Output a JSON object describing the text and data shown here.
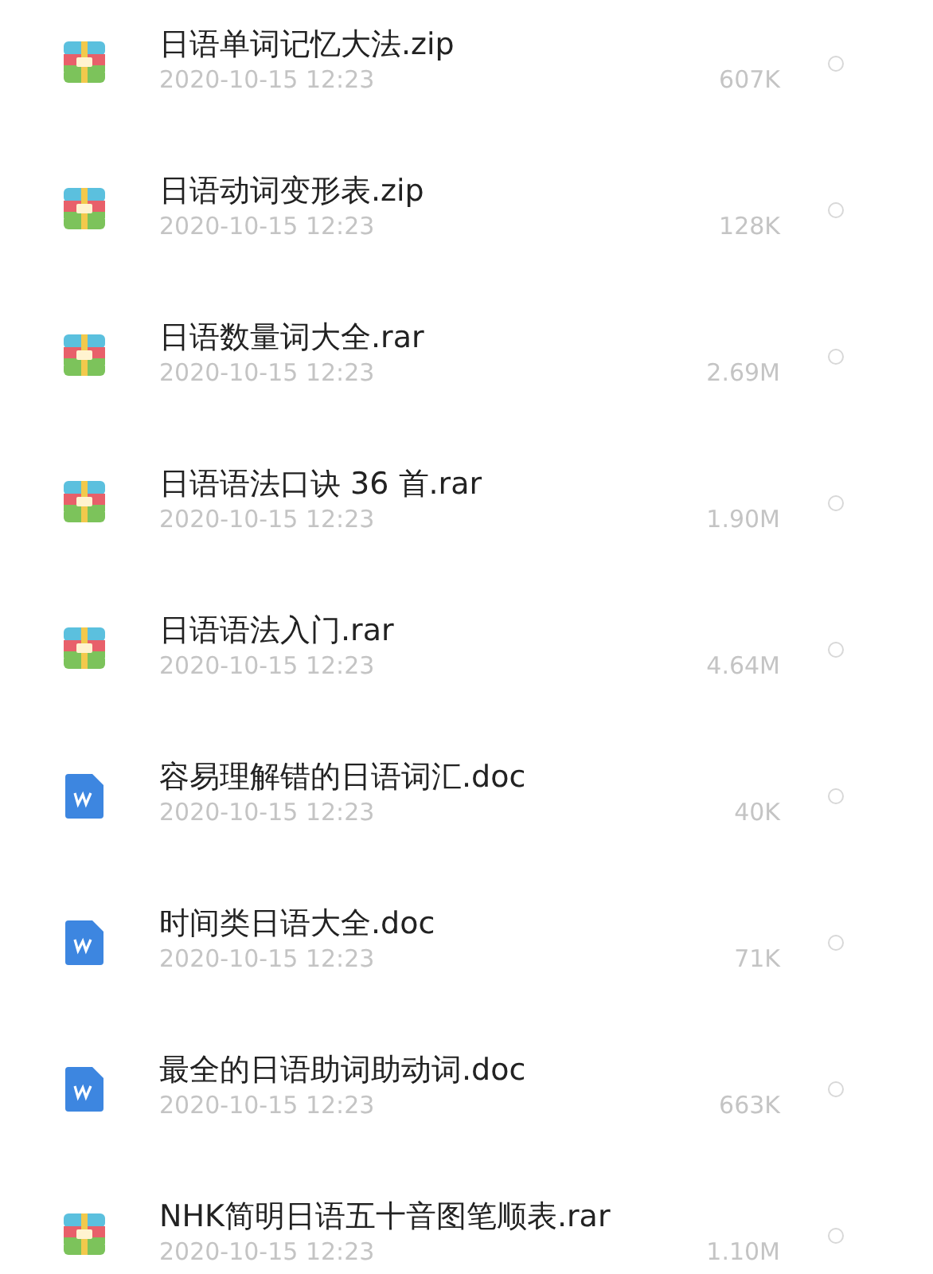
{
  "files": [
    {
      "kind": "archive",
      "name": "日语单词记忆大法.zip",
      "date": "2020-10-15 12:23",
      "size": "607K",
      "selected": false
    },
    {
      "kind": "archive",
      "name": "日语动词变形表.zip",
      "date": "2020-10-15 12:23",
      "size": "128K",
      "selected": false
    },
    {
      "kind": "archive",
      "name": "日语数量词大全.rar",
      "date": "2020-10-15 12:23",
      "size": "2.69M",
      "selected": false
    },
    {
      "kind": "archive",
      "name": "日语语法口诀 36 首.rar",
      "date": "2020-10-15 12:23",
      "size": "1.90M",
      "selected": false
    },
    {
      "kind": "archive",
      "name": "日语语法入门.rar",
      "date": "2020-10-15 12:23",
      "size": "4.64M",
      "selected": false
    },
    {
      "kind": "word",
      "name": "容易理解错的日语词汇.doc",
      "date": "2020-10-15 12:23",
      "size": "40K",
      "selected": false
    },
    {
      "kind": "word",
      "name": "时间类日语大全.doc",
      "date": "2020-10-15 12:23",
      "size": "71K",
      "selected": false
    },
    {
      "kind": "word",
      "name": "最全的日语助词助动词.doc",
      "date": "2020-10-15 12:23",
      "size": "663K",
      "selected": false
    },
    {
      "kind": "archive",
      "name": "NHK简明日语五十音图笔顺表.rar",
      "date": "2020-10-15 12:23",
      "size": "1.10M",
      "selected": false
    }
  ]
}
